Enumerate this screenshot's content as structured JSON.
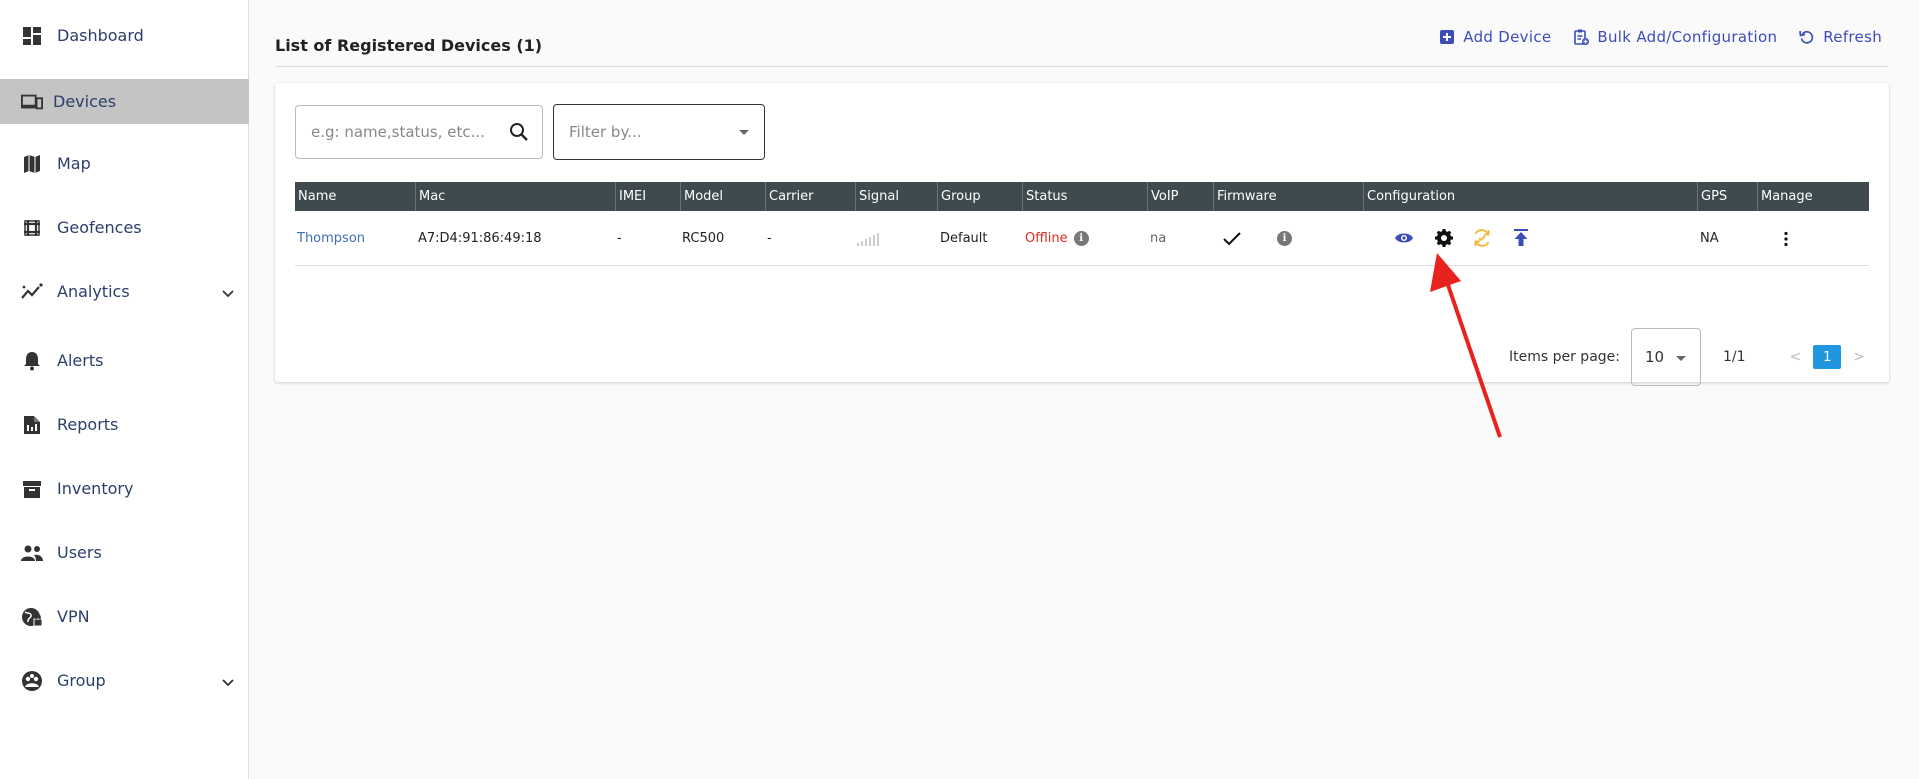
{
  "sidebar": {
    "items": [
      {
        "label": "Dashboard",
        "icon": "dashboard-icon"
      },
      {
        "label": "Devices",
        "icon": "devices-icon",
        "active": true
      },
      {
        "label": "Map",
        "icon": "map-icon"
      },
      {
        "label": "Geofences",
        "icon": "geofences-icon"
      },
      {
        "label": "Analytics",
        "icon": "analytics-icon",
        "expandable": true
      },
      {
        "label": "Alerts",
        "icon": "bell-icon"
      },
      {
        "label": "Reports",
        "icon": "reports-icon"
      },
      {
        "label": "Inventory",
        "icon": "inventory-icon"
      },
      {
        "label": "Users",
        "icon": "users-icon"
      },
      {
        "label": "VPN",
        "icon": "vpn-icon"
      },
      {
        "label": "Group",
        "icon": "group-icon",
        "expandable": true
      }
    ]
  },
  "header": {
    "title": "List of Registered Devices (1)",
    "actions": {
      "add_device": "Add Device",
      "bulk_add": "Bulk Add/Configuration",
      "refresh": "Refresh"
    }
  },
  "search": {
    "placeholder": "e.g: name,status, etc..."
  },
  "filter": {
    "placeholder": "Filter by..."
  },
  "table": {
    "columns": [
      "Name",
      "Mac",
      "IMEI",
      "Model",
      "Carrier",
      "Signal",
      "Group",
      "Status",
      "VoIP",
      "Firmware",
      "Configuration",
      "GPS",
      "Manage"
    ],
    "rows": [
      {
        "name": "Thompson",
        "mac": "A7:D4:91:86:49:18",
        "imei": "-",
        "model": "RC500",
        "carrier": "-",
        "group": "Default",
        "status": "Offline",
        "voip": "na",
        "gps": "NA"
      }
    ]
  },
  "pagination": {
    "items_per_page_label": "Items per page:",
    "items_per_page": "10",
    "range": "1/1",
    "prev": "<",
    "current_page": "1",
    "next": ">"
  },
  "colors": {
    "accent": "#3d4db7",
    "link": "#3f6fb5",
    "offline": "#e12a1f",
    "config_sync": "#f5b52e",
    "annotation_arrow": "#e8231d",
    "page_active": "#2196e0"
  }
}
